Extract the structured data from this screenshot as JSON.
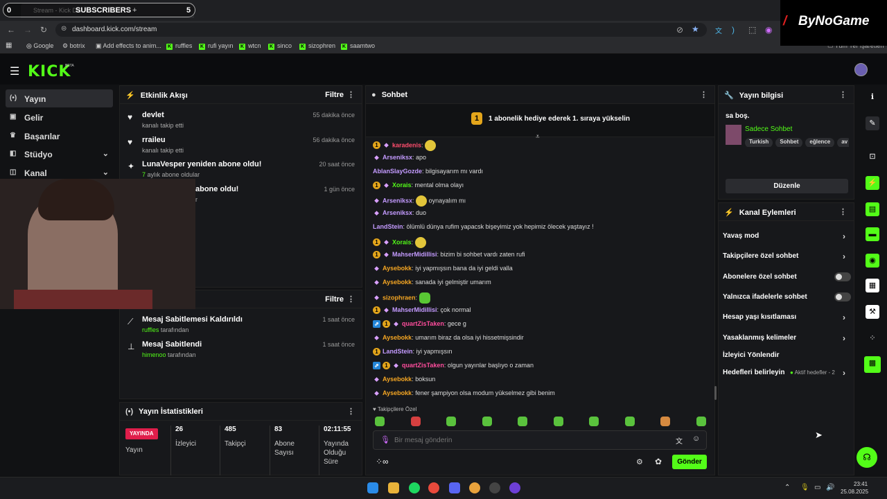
{
  "browser": {
    "tab_title": "Stream - Kick Da",
    "subs_left": "0",
    "subs_label": "SUBSCRIBERS",
    "subs_right": "5",
    "new_tab": "+",
    "url": "dashboard.kick.com/stream",
    "watermark": "ByNoGame",
    "bookmarks": [
      "Google",
      "botrix",
      "Add effects to anim...",
      "ruffles",
      "rufi yayın",
      "wtcn",
      "sinco",
      "sizophren",
      "saamtwo"
    ],
    "all_bookmarks": "Tüm Yer İşaretleri"
  },
  "sidebar": {
    "items": [
      {
        "label": "Yayın",
        "icon": "broadcast-icon"
      },
      {
        "label": "Gelir",
        "icon": "money-icon"
      },
      {
        "label": "Başarılar",
        "icon": "trophy-icon"
      },
      {
        "label": "Stüdyo",
        "icon": "studio-icon"
      },
      {
        "label": "Kanal",
        "icon": "channel-icon"
      }
    ]
  },
  "activity": {
    "title": "Etkinlik Akışı",
    "filter": "Filtre",
    "events": [
      {
        "title": "devlet",
        "sub": "kanalı takip etti",
        "time": "55 dakika önce"
      },
      {
        "title": "rraileu",
        "sub": "kanalı takip etti",
        "time": "56 dakika önce"
      },
      {
        "title": "LunaVesper yeniden abone oldu!",
        "sub_hl": "7",
        "sub": "aylık abone oldular",
        "time": "20 saat önce"
      },
      {
        "title": "abone oldu!",
        "sub": "r",
        "time": "1 gün önce"
      }
    ]
  },
  "mod": {
    "filter": "Filtre",
    "events": [
      {
        "title": "Mesaj Sabitlemesi Kaldırıldı",
        "user": "ruffles",
        "sub": "tarafından",
        "time": "1 saat önce"
      },
      {
        "title": "Mesaj Sabitlendi",
        "user": "himenoo",
        "sub": "tarafından",
        "time": "1 saat önce"
      }
    ]
  },
  "stats": {
    "title": "Yayın İstatistikleri",
    "live_badge": "YAYINDA",
    "live_label": "Yayın",
    "viewers": "26",
    "viewers_label": "İzleyici",
    "followers": "485",
    "followers_label": "Takipçi",
    "subs": "83",
    "subs_label": "Abone Sayısı",
    "duration": "02:11:55",
    "duration_label": "Yayında Olduğu Süre"
  },
  "chat": {
    "title": "Sohbet",
    "gift_banner": "1 abonelik hediye ederek 1. sıraya yükselin",
    "messages": [
      {
        "user": "karadenis",
        "text": "",
        "color": "#ff4d6d",
        "badges": [
          "1",
          "g"
        ],
        "emote": "y"
      },
      {
        "user": "Arseniksx",
        "text": "apo",
        "color": "#c49bff",
        "badges": [
          "g"
        ]
      },
      {
        "user": "AblanSlayGozde",
        "text": "bilgisayarım mı vardı",
        "color": "#c49bff",
        "badges": []
      },
      {
        "user": "Xorais",
        "text": "mental olma olayı",
        "color": "#53fc18",
        "badges": [
          "1",
          "g"
        ]
      },
      {
        "user": "Arseniksx",
        "text": "oynayalım mı",
        "color": "#c49bff",
        "badges": [
          "g"
        ],
        "emote": "y"
      },
      {
        "user": "Arseniksx",
        "text": "duo",
        "color": "#c49bff",
        "badges": [
          "g"
        ]
      },
      {
        "user": "LandStein",
        "text": "ölümlü dünya rufim yapacsk bişeyimiz yok hepimiz ölecek yaştayız !",
        "color": "#c49bff",
        "badges": []
      },
      {
        "user": "Xorais",
        "text": "",
        "color": "#53fc18",
        "badges": [
          "1",
          "g"
        ],
        "emote": "y"
      },
      {
        "user": "MahserMidillisi",
        "text": "bizim bi sohbet vardı zaten rufi",
        "color": "#c49bff",
        "badges": [
          "1",
          "g"
        ]
      },
      {
        "user": "Aysebokk",
        "text": "iyi yapmışsın bana da iyi geldi valla",
        "color": "#f5a623",
        "badges": [
          "g"
        ]
      },
      {
        "user": "Aysebokk",
        "text": "sanada iyi gelmiştir umarım",
        "color": "#f5a623",
        "badges": [
          "g"
        ]
      },
      {
        "user": "sizophraen",
        "text": "",
        "color": "#f5a623",
        "badges": [
          "g"
        ],
        "emote": "g"
      },
      {
        "user": "MahserMidillisi",
        "text": "çok normal",
        "color": "#c49bff",
        "badges": [
          "1",
          "g"
        ]
      },
      {
        "user": "quartZisTaken",
        "text": "gece g",
        "color": "#ff4d9d",
        "badges": [
          "v",
          "1",
          "g"
        ]
      },
      {
        "user": "Aysebokk",
        "text": "umarım biraz da olsa iyi hissetmişsindir",
        "color": "#f5a623",
        "badges": [
          "g"
        ]
      },
      {
        "user": "LandStein",
        "text": "iyi yapmışsın",
        "color": "#c49bff",
        "badges": [
          "1"
        ]
      },
      {
        "user": "quartZisTaken",
        "text": "olgun yayınlar başlıyo o zaman",
        "color": "#ff4d9d",
        "badges": [
          "v",
          "1",
          "g"
        ]
      },
      {
        "user": "Aysebokk",
        "text": "boksun",
        "color": "#f5a623",
        "badges": [
          "g"
        ]
      },
      {
        "user": "Aysebokk",
        "text": "fener şampiyon olsa modum yükselmez gibi benim",
        "color": "#f5a623",
        "badges": [
          "g"
        ]
      }
    ],
    "followers_only": "Takipçilere Özel",
    "input_placeholder": "Bir mesaj gönderin",
    "send": "Gönder"
  },
  "stream_info": {
    "title": "Yayın bilgisi",
    "stream_title": "sa boş.",
    "category": "Sadece Sohbet",
    "tags": [
      "Turkish",
      "Sohbet",
      "eğlence",
      "av"
    ],
    "edit": "Düzenle"
  },
  "channel_actions": {
    "title": "Kanal Eylemleri",
    "items": [
      {
        "label": "Yavaş mod",
        "kind": "arrow"
      },
      {
        "label": "Takipçilere özel sohbet",
        "kind": "arrow"
      },
      {
        "label": "Abonelere özel sohbet",
        "kind": "toggle"
      },
      {
        "label": "Yalnızca ifadelerle sohbet",
        "kind": "toggle"
      },
      {
        "label": "Hesap yaşı kısıtlaması",
        "kind": "arrow"
      },
      {
        "label": "Yasaklanmış kelimeler",
        "kind": "arrow"
      },
      {
        "label": "İzleyici Yönlendir",
        "kind": "none"
      },
      {
        "label": "Hedefleri belirleyin",
        "kind": "arrow",
        "extra": "Aktif hedefler - 2"
      }
    ]
  },
  "taskbar": {
    "time": "23:41",
    "date": "25.08.2025"
  },
  "colors": {
    "brand": "#53fc18",
    "live": "#e01e4b",
    "panel": "#17181b"
  }
}
